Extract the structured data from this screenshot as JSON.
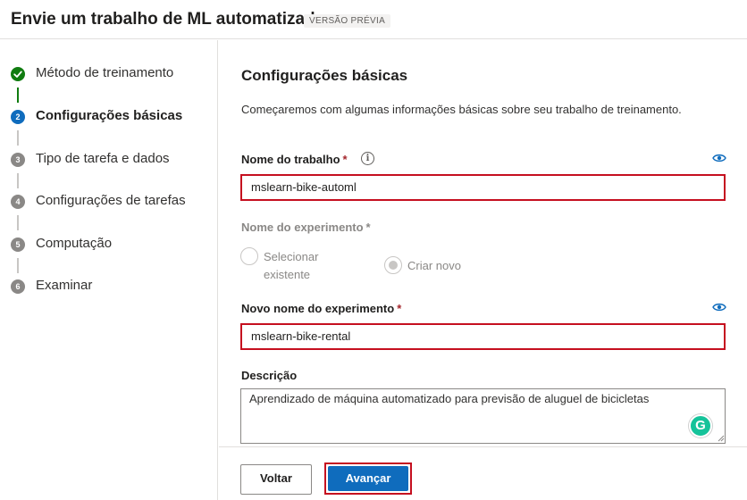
{
  "header": {
    "title": "Envie um trabalho de ML automatizado",
    "badge": "VERSÃO PRÉVIA"
  },
  "steps": [
    {
      "number": "",
      "label": "Método de treinamento",
      "state": "complete"
    },
    {
      "number": "2",
      "label": "Configurações básicas",
      "state": "active"
    },
    {
      "number": "3",
      "label": "Tipo de tarefa e dados",
      "state": "pending"
    },
    {
      "number": "4",
      "label": "Configurações de tarefas",
      "state": "pending"
    },
    {
      "number": "5",
      "label": "Computação",
      "state": "pending"
    },
    {
      "number": "6",
      "label": "Examinar",
      "state": "pending"
    }
  ],
  "main": {
    "section_title": "Configurações básicas",
    "intro": "Começaremos com algumas informações básicas sobre seu trabalho de treinamento.",
    "job_name": {
      "label": "Nome do trabalho",
      "required_mark": "*",
      "value": "mslearn-bike-automl"
    },
    "experiment_name": {
      "label": "Nome do experimento",
      "required_mark": "*",
      "options": [
        {
          "label_line1": "Selecionar",
          "label_line2": "existente",
          "selected": false
        },
        {
          "label": "Criar novo",
          "selected": true
        }
      ]
    },
    "new_experiment_name": {
      "label": "Novo nome do experimento",
      "required_mark": "*",
      "value": "mslearn-bike-rental"
    },
    "description": {
      "label": "Descrição",
      "value": "Aprendizado de máquina automatizado para previsão de aluguel de bicicletas"
    }
  },
  "footer": {
    "back_label": "Voltar",
    "next_label": "Avançar"
  },
  "colors": {
    "primary": "#0f6cbd",
    "success": "#107c10",
    "highlight_border": "#c50f1f",
    "grammarly": "#15c39a"
  },
  "icons": {
    "info": "info-icon",
    "visibility": "eye-icon",
    "checkmark": "check-icon",
    "grammarly": "grammarly-icon"
  }
}
